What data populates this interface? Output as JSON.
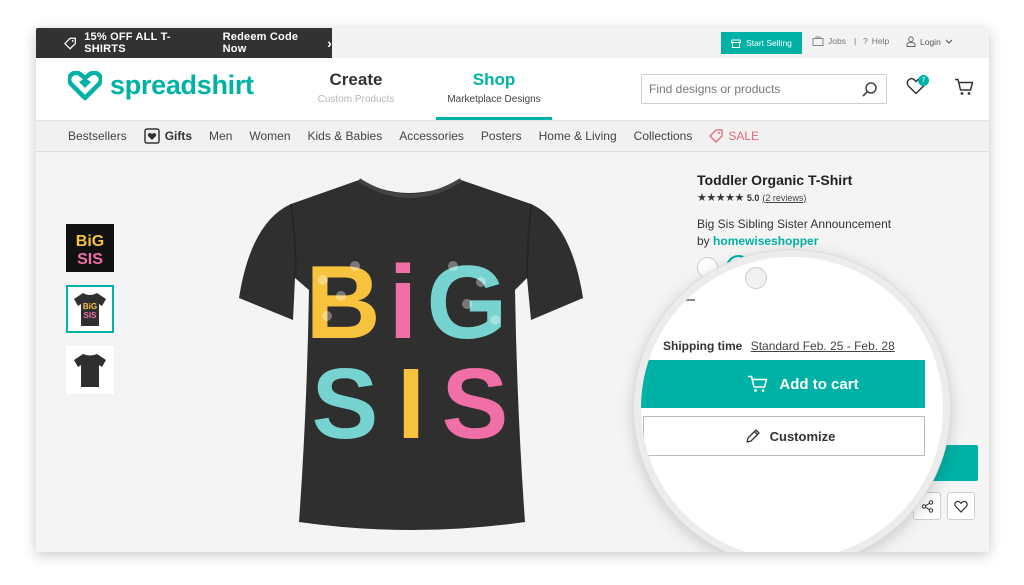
{
  "promo": {
    "text": "15% OFF ALL T-SHIRTS",
    "redeem": "Redeem Code Now",
    "chevron": "›"
  },
  "top_util": {
    "start_selling": "Start Selling",
    "jobs": "Jobs",
    "help": "Help",
    "login": "Login",
    "sep": "|",
    "help_icon": "?"
  },
  "brand": {
    "name": "spreadshirt",
    "accent": "#00b2a5"
  },
  "nav": {
    "create": {
      "label": "Create",
      "sub": "Custom Products"
    },
    "shop": {
      "label": "Shop",
      "sub": "Marketplace Designs"
    }
  },
  "search": {
    "placeholder": "Find designs or products"
  },
  "wishlist": {
    "count": "7"
  },
  "categories": [
    "Bestsellers",
    "Gifts",
    "Men",
    "Women",
    "Kids & Babies",
    "Accessories",
    "Posters",
    "Home & Living",
    "Collections",
    "SALE"
  ],
  "product": {
    "title": "Toddler Organic T-Shirt",
    "stars": "★★★★★",
    "rating": "5.0",
    "reviews": "(2 reviews)",
    "design": "Big Sis Sibling Sister Announcement",
    "by": "by",
    "author": "homewiseshopper",
    "design_letters": {
      "line1": [
        "B",
        "i",
        "G"
      ],
      "line2": [
        "S",
        "I",
        "S"
      ]
    },
    "thumb_text": {
      "top": "BiG",
      "bottom": "SIS"
    }
  },
  "shipping": {
    "label": "Shipping time",
    "value": "Standard Feb. 25 - Feb. 28"
  },
  "actions": {
    "add_to_cart": "Add to cart",
    "customize": "Customize"
  },
  "colors": {
    "teal": "#00b2a5",
    "sale": "#e8677a",
    "shirt": "#2f2f2f"
  }
}
